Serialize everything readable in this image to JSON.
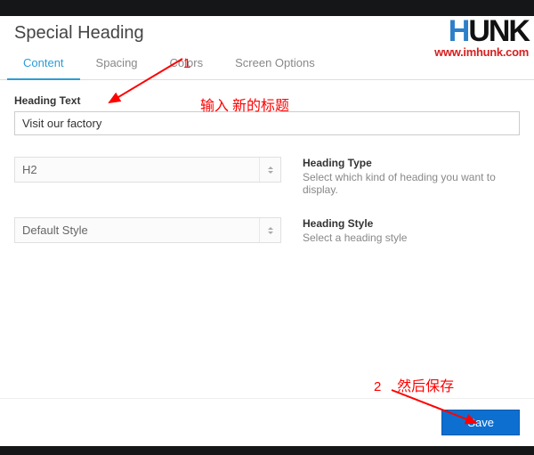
{
  "modal": {
    "title": "Special Heading"
  },
  "tabs": {
    "content": "Content",
    "spacing": "Spacing",
    "colors": "Colors",
    "screen_options": "Screen Options"
  },
  "fields": {
    "heading_text_label": "Heading Text",
    "heading_text_value": "Visit our factory",
    "heading_type": {
      "value": "H2",
      "label": "Heading Type",
      "desc": "Select which kind of heading you want to display."
    },
    "heading_style": {
      "value": "Default Style",
      "label": "Heading Style",
      "desc": "Select a heading style"
    }
  },
  "footer": {
    "save": "Save"
  },
  "annotations": {
    "num1": "1",
    "text1": "输入 新的标题",
    "num2": "2",
    "text2": "然后保存"
  },
  "logo": {
    "main_h": "H",
    "main_rest": "UNK",
    "url": "www.imhunk.com"
  }
}
